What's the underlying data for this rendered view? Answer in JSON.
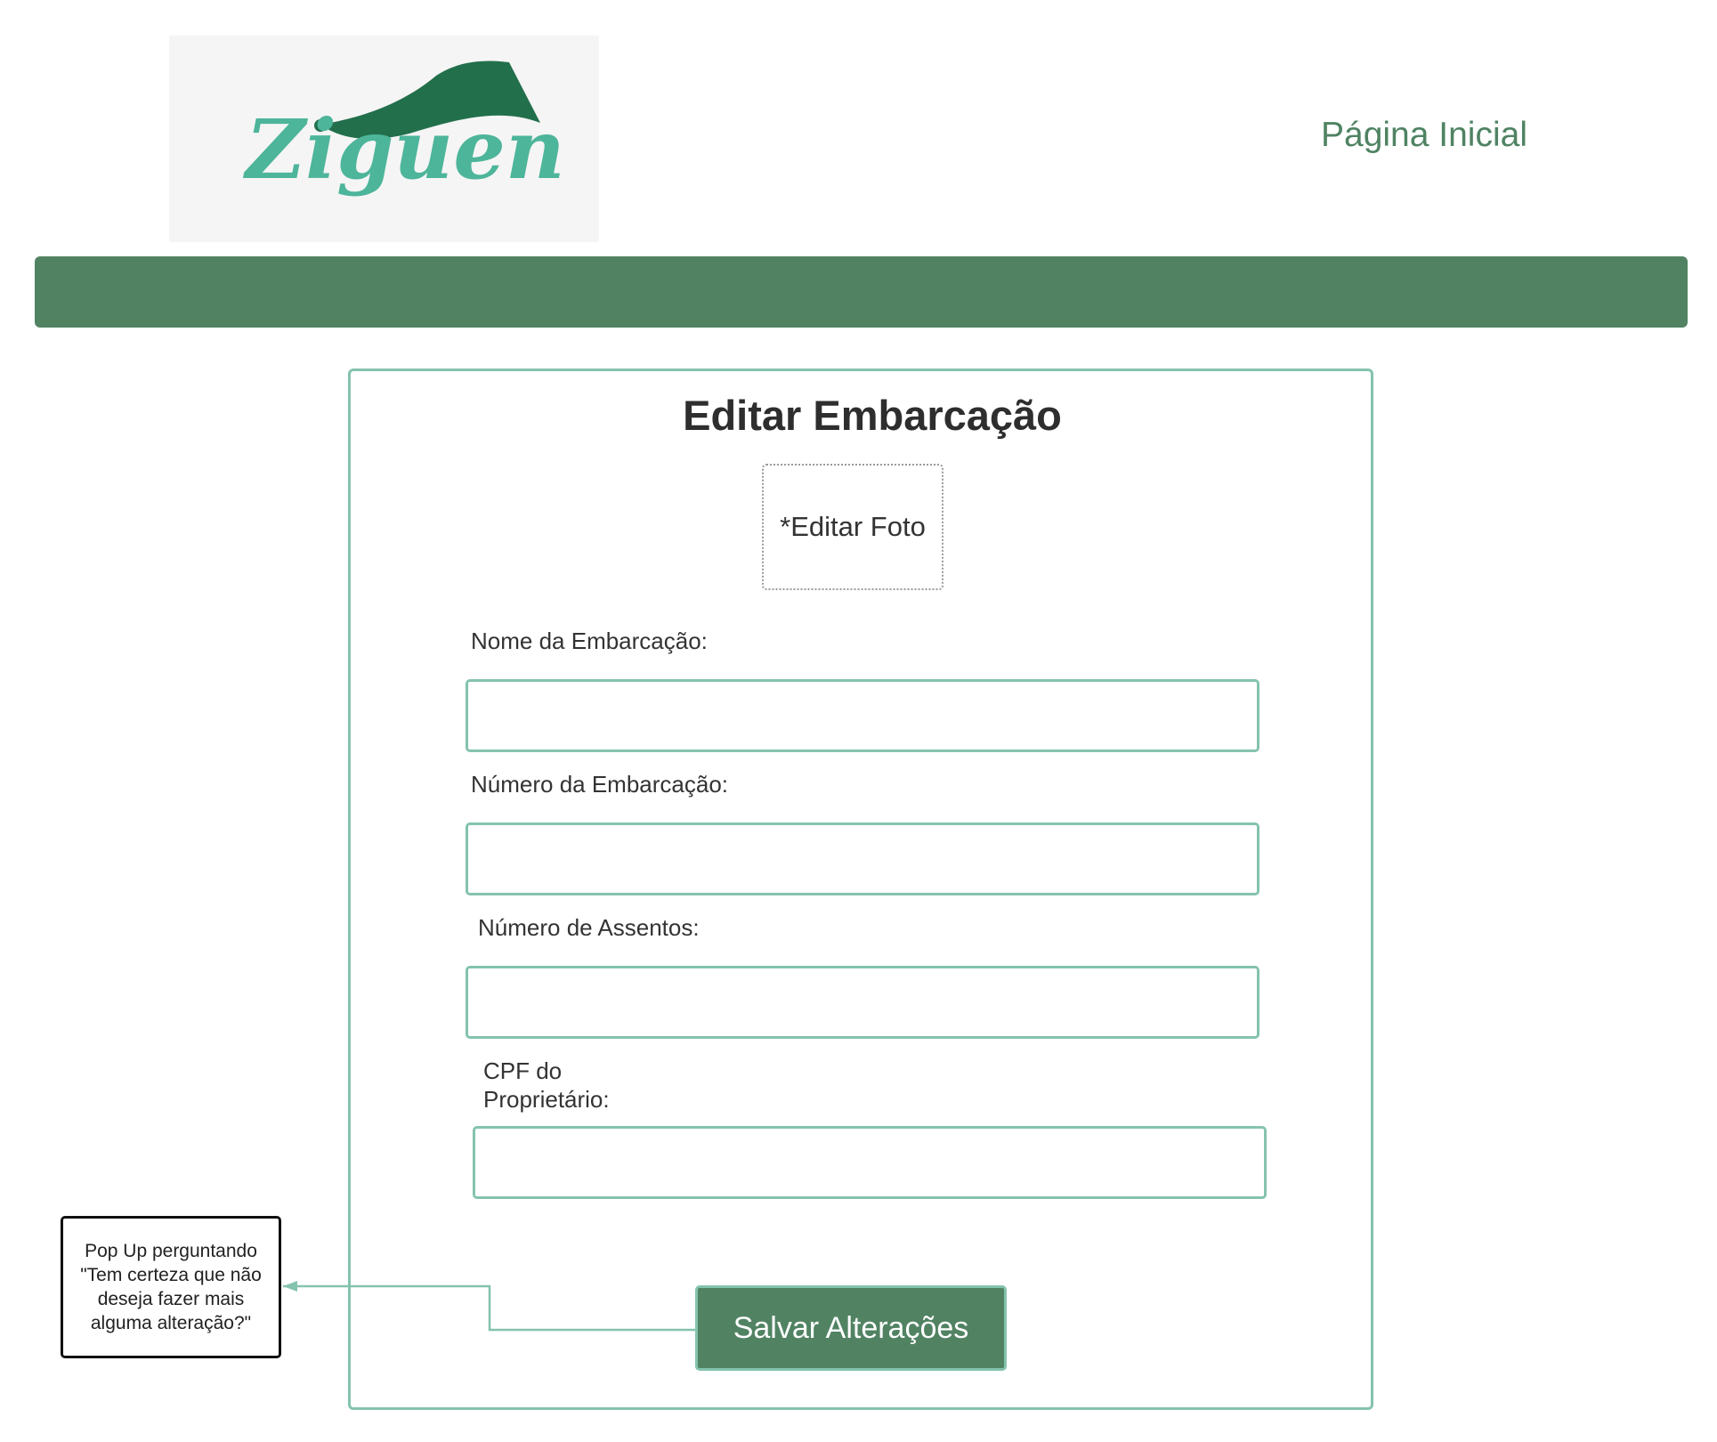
{
  "header": {
    "logo_text": "Ziguen",
    "nav_home": "Página Inicial"
  },
  "colors": {
    "brand_green": "#518363",
    "logo_teal": "#4db59a",
    "logo_dark_green": "#226f4c",
    "field_border": "#84c3ae"
  },
  "form": {
    "title": "Editar Embarcação",
    "photo_button": "*Editar Foto",
    "fields": [
      {
        "label": "Nome da Embarcação:",
        "value": ""
      },
      {
        "label": "Número da Embarcação:",
        "value": ""
      },
      {
        "label": "Número de Assentos:",
        "value": ""
      },
      {
        "label_line1": "CPF do",
        "label_line2": "Proprietário:",
        "value": ""
      }
    ],
    "save_button": "Salvar Alterações"
  },
  "annotation": {
    "line1": "Pop Up perguntando",
    "line2": "\"Tem certeza que não",
    "line3": "deseja fazer mais",
    "line4": "alguma alteração?\""
  }
}
